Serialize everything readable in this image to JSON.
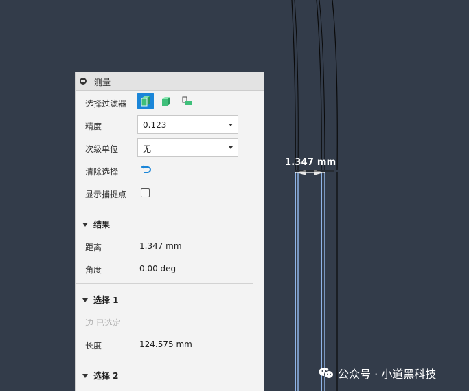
{
  "panel": {
    "title": "测量",
    "rows": {
      "filter_label": "选择过滤器",
      "precision_label": "精度",
      "precision_value": "0.123",
      "subunit_label": "次级单位",
      "subunit_value": "无",
      "clear_label": "清除选择",
      "snap_label": "显示捕捉点",
      "snap_checked": false
    },
    "results": {
      "header": "结果",
      "distance_label": "距离",
      "distance_value": "1.347 mm",
      "angle_label": "角度",
      "angle_value": "0.00 deg"
    },
    "selection1": {
      "header": "选择 1",
      "edge_selected": "边 已选定",
      "length_label": "长度",
      "length_value": "124.575 mm"
    },
    "selection2": {
      "header": "选择 2"
    }
  },
  "canvas": {
    "dimension_label": "1.347 mm"
  },
  "watermark": {
    "text": "公众号 · 小道黑科技"
  },
  "colors": {
    "background": "#333c4a",
    "accent": "#1b86d8",
    "edge_highlight": "#8fb4e6",
    "cube_green": "#3fbf7a"
  }
}
